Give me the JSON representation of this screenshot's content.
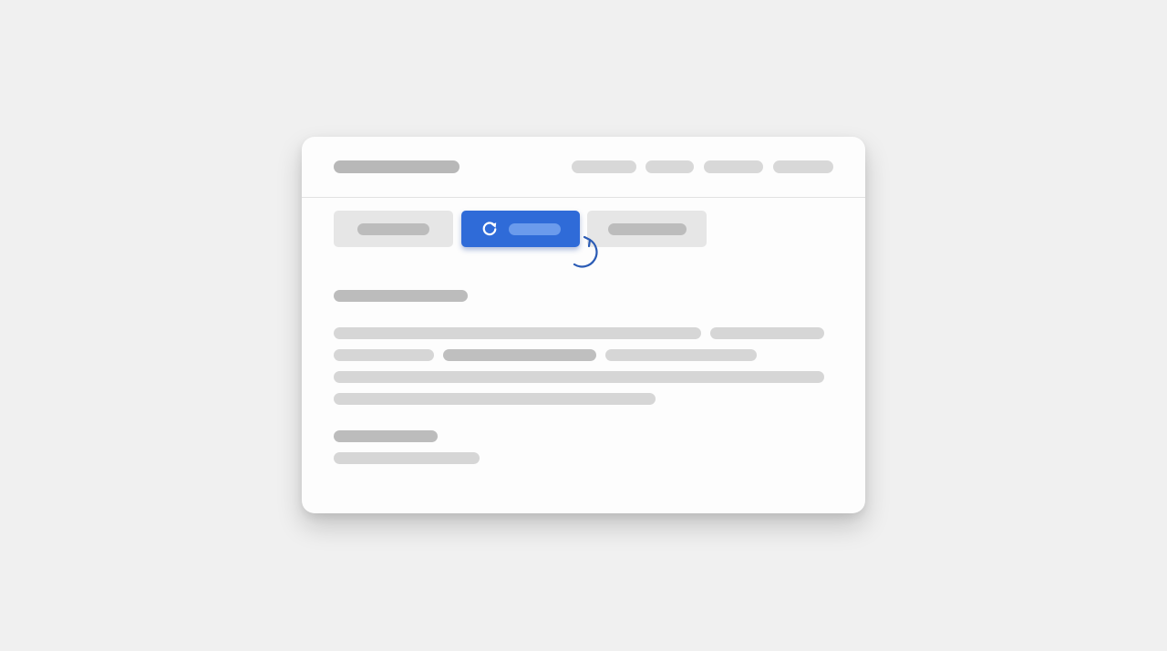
{
  "theme": {
    "background": "#f0f0f0",
    "window_background": "#fdfdfd",
    "accent": "#2f6bd8",
    "placeholder_light": "#d6d6d6",
    "placeholder_dark": "#bcbcbc"
  },
  "header": {
    "title_placeholder": true,
    "nav_items": [
      {
        "kind": "placeholder"
      },
      {
        "kind": "placeholder"
      },
      {
        "kind": "placeholder"
      },
      {
        "kind": "placeholder"
      }
    ]
  },
  "tabs": [
    {
      "state": "inactive"
    },
    {
      "state": "active",
      "icon": "refresh-icon"
    },
    {
      "state": "inactive"
    }
  ],
  "annotation": {
    "icon": "curved-arrow-cursor-icon",
    "target": "tab-2"
  },
  "content": {
    "sections": [
      {
        "title_placeholder": true,
        "line_count": 4
      },
      {
        "title_placeholder": true,
        "line_count": 1
      }
    ]
  }
}
